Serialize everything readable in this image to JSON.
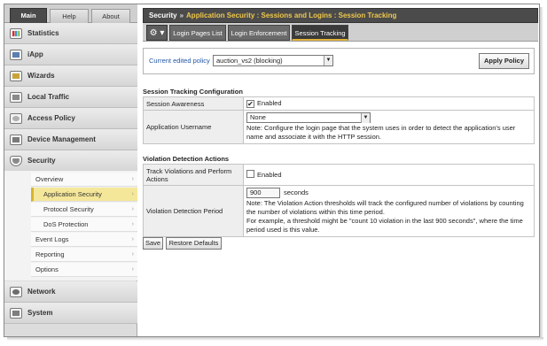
{
  "nav": {
    "tabs": [
      "Main",
      "Help",
      "About"
    ],
    "items": [
      "Statistics",
      "iApp",
      "Wizards",
      "Local Traffic",
      "Access Policy",
      "Device Management",
      "Security",
      "Network",
      "System"
    ],
    "icons": [
      "statistics-icon",
      "iapp-icon",
      "wizards-icon",
      "local-traffic-icon",
      "access-policy-icon",
      "device-management-icon",
      "security-icon",
      "network-icon",
      "system-icon"
    ],
    "security_sub": [
      "Overview",
      "Application Security",
      "Protocol Security",
      "DoS Protection",
      "Event Logs",
      "Reporting",
      "Options"
    ],
    "arrow": "›"
  },
  "header": {
    "section": "Security",
    "separator": "»",
    "trail": "Application Security : Sessions and Logins : Session Tracking"
  },
  "tabs": {
    "gear": "⚙ ▾",
    "items": [
      "Login Pages List",
      "Login Enforcement",
      "Session Tracking"
    ],
    "active": "Session Tracking"
  },
  "policy": {
    "label": "Current edited policy",
    "value": "auction_vs2 (blocking)",
    "apply_label": "Apply Policy"
  },
  "session_tracking": {
    "title": "Session Tracking Configuration",
    "awareness_label": "Session Awareness",
    "awareness_value": "Enabled",
    "awareness_checked": true,
    "username_label": "Application Username",
    "username_value": "None",
    "username_note": "Note: Configure the login page that the system uses in order to detect the application's user name and associate it with the HTTP session."
  },
  "violation_detection": {
    "title": "Violation Detection Actions",
    "track_label": "Track Violations and Perform Actions",
    "track_value": "Enabled",
    "track_checked": false,
    "period_label": "Violation Detection Period",
    "period_value": "900",
    "period_unit": "seconds",
    "period_note1": "Note: The Violation Action thresholds will track the configured number of violations by counting the number of violations within this time period.",
    "period_note2": "For example, a threshold might be \"count 10 violation in the last 900 seconds\", where the time period used is this value."
  },
  "buttons": {
    "save": "Save",
    "restore": "Restore Defaults"
  }
}
